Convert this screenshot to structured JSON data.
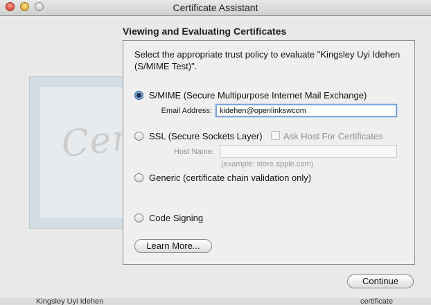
{
  "window": {
    "title": "Certificate Assistant"
  },
  "heading": "Viewing and Evaluating Certificates",
  "intro": "Select the appropriate trust policy to evaluate \"Kingsley Uyi Idehen (S/MIME Test)\".",
  "art": {
    "word": "Certificate"
  },
  "options": {
    "smime": {
      "label": "S/MIME (Secure Multipurpose Internet Mail Exchange)",
      "selected": true
    },
    "email_label": "Email Address:",
    "email_value": "kidehen@openlinkswcom",
    "ssl": {
      "label": "SSL (Secure Sockets Layer)",
      "selected": false
    },
    "ask_host_label": "Ask Host For Certificates",
    "host_label": "Host Name:",
    "host_value": "",
    "host_hint": "(example:  store.apple.com)",
    "generic": {
      "label": "Generic (certificate chain validation only)",
      "selected": false
    },
    "codesign": {
      "label": "Code Signing",
      "selected": false
    }
  },
  "buttons": {
    "learn_more": "Learn More...",
    "continue": "Continue"
  },
  "background_strip": {
    "left": "Kingsley Uyi Idehen",
    "right": "certificate"
  }
}
